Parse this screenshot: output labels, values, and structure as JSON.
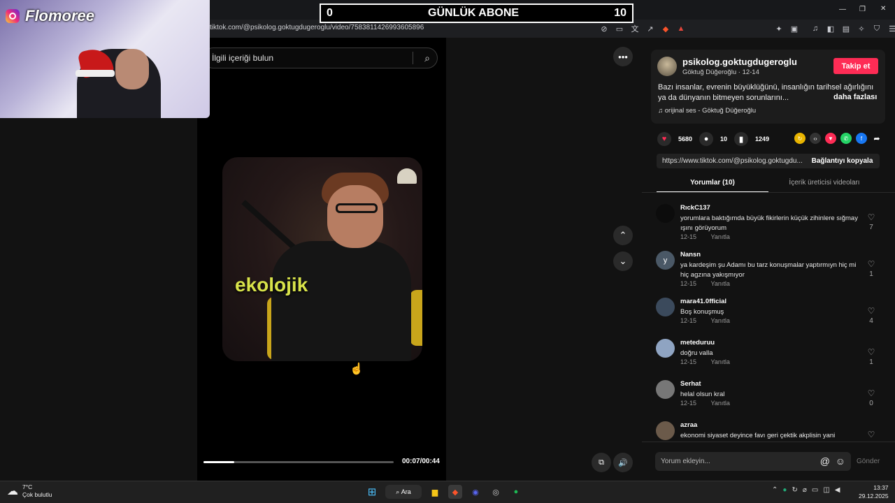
{
  "overlay": {
    "streamer_name": "Flomoree",
    "abone_left": "0",
    "abone_title": "GÜNLÜK ABONE",
    "abone_right": "10"
  },
  "browser": {
    "url": "tiktok.com/@psikolog.goktugdugeroglu/video/7583811426993605896"
  },
  "video": {
    "search_placeholder": "İlgili içeriği bulun",
    "caption": "ekolojik",
    "time": "00:07/00:44",
    "progress": 0.16
  },
  "post": {
    "username": "psikolog.goktugdugeroglu",
    "display_name": "Göktuğ Düğeroğlu",
    "date": "12-14",
    "follow_label": "Takip et",
    "description": "Bazı insanlar, evrenin büyüklüğünü, insanlığın tarihsel ağırlığını ya da dünyanın bitmeyen sorunlarını...",
    "more_label": "daha fazlası",
    "music": "orijinal ses - Göktuğ Düğeroğlu",
    "likes": "5680",
    "comments": "10",
    "saves": "1249",
    "link": "https://www.tiktok.com/@psikolog.goktugdu...",
    "copy_label": "Bağlantıyı kopyala"
  },
  "tabs": [
    {
      "label": "Yorumlar (10)"
    },
    {
      "label": "İçerik üreticisi videoları"
    }
  ],
  "reply_label": "Yanıtla",
  "comments": [
    {
      "user": "RıckC137",
      "text": "yorumlara baktığımda büyük fikirlerin küçük zihinlere sığmay ışını görüyorum",
      "date": "12-15",
      "likes": "7",
      "avatar_color": "#0c0c0c"
    },
    {
      "user": "Nansn",
      "text": "ya kardeşim şu Adamı bu tarz konuşmalar yaptırmıyn hiç mi hiç agzına yakışmıyor",
      "date": "12-15",
      "likes": "1",
      "avatar_color": "#4a5866",
      "avatar_letter": "y"
    },
    {
      "user": "mara41.0fficial",
      "text": "Boş konuşmuş",
      "date": "12-15",
      "likes": "4",
      "avatar_color": "#3b4a5c"
    },
    {
      "user": "meteduruu",
      "text": "doğru valla",
      "date": "12-15",
      "likes": "1",
      "avatar_color": "#8fa4c2"
    },
    {
      "user": "Serhat",
      "text": "helal olsun kral",
      "date": "12-15",
      "likes": "0",
      "avatar_color": "#777777"
    },
    {
      "user": "azraa",
      "text": "ekonomi siyaset deyince favı geri çektik akplisin yani",
      "date": "",
      "likes": "",
      "avatar_color": "#6b5a4a"
    }
  ],
  "comment_input": {
    "placeholder": "Yorum ekleyin...",
    "send_label": "Gönder"
  },
  "taskbar": {
    "temp": "7°C",
    "weather": "Çok bulutlu",
    "search_label": "Ara",
    "time": "13:37",
    "date": "29.12.2025"
  },
  "colors": {
    "accent": "#fe2c55",
    "caption": "#d8e34a"
  }
}
